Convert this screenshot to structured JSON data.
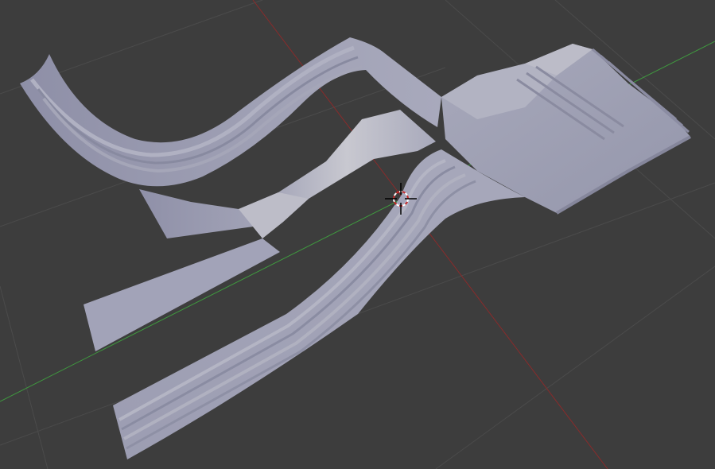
{
  "viewport": {
    "background_color": "#3d3d3d",
    "grid_color": "#4b4b4b",
    "x_axis_color": "#8a2b2b",
    "y_axis_color": "#3f9a3f",
    "mesh_color": "#9fa0b0",
    "cursor_colors": [
      "#ffffff",
      "#c62828",
      "#000000"
    ]
  },
  "scene": {
    "objects": [
      {
        "name": "molding-strip-curved-upper"
      },
      {
        "name": "flat-ribbon-bent"
      },
      {
        "name": "molding-strip-lower-straight"
      },
      {
        "name": "corner-block"
      }
    ],
    "cursor": {
      "icon": "3d-cursor-icon"
    }
  }
}
